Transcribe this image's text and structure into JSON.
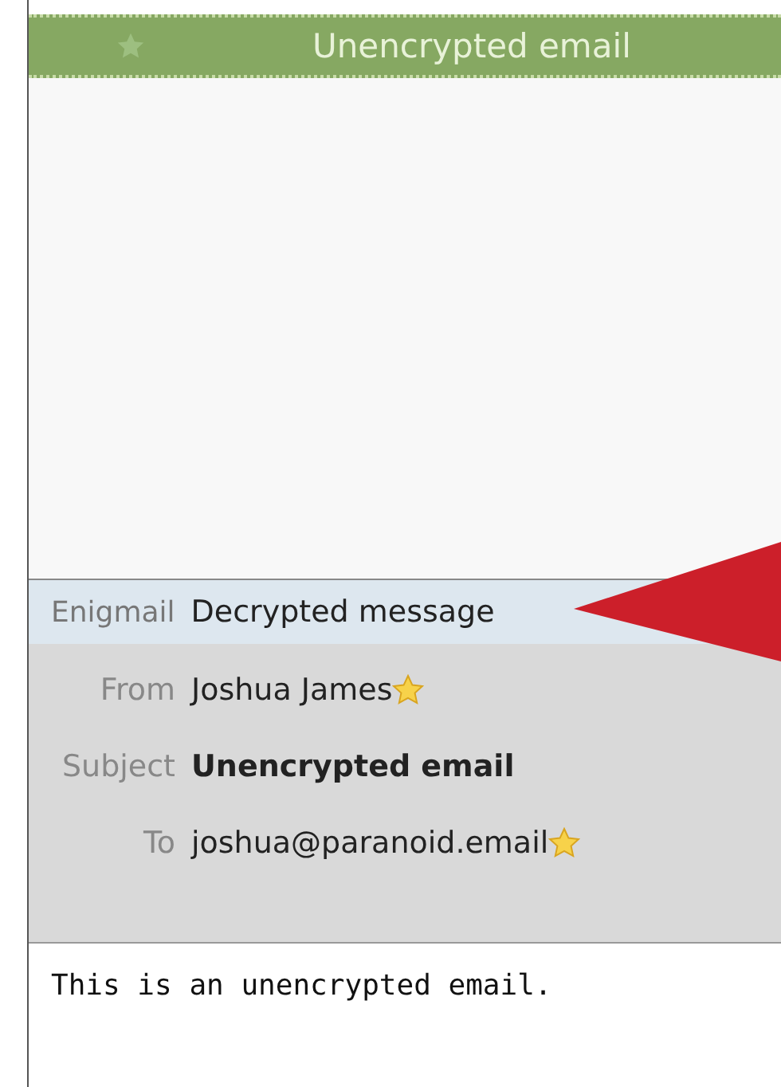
{
  "title_bar": {
    "title": "Unencrypted email",
    "starred": false
  },
  "security_bar": {
    "label": "Enigmail",
    "status": "Decrypted message"
  },
  "headers": [
    {
      "kind": "contact",
      "label": "From",
      "value": "Joshua James"
    },
    {
      "kind": "subject",
      "label": "Subject",
      "value": "Unencrypted email"
    },
    {
      "kind": "contact",
      "label": "To",
      "value": "joshua@paranoid.email"
    }
  ],
  "body": "This is an unencrypted email."
}
